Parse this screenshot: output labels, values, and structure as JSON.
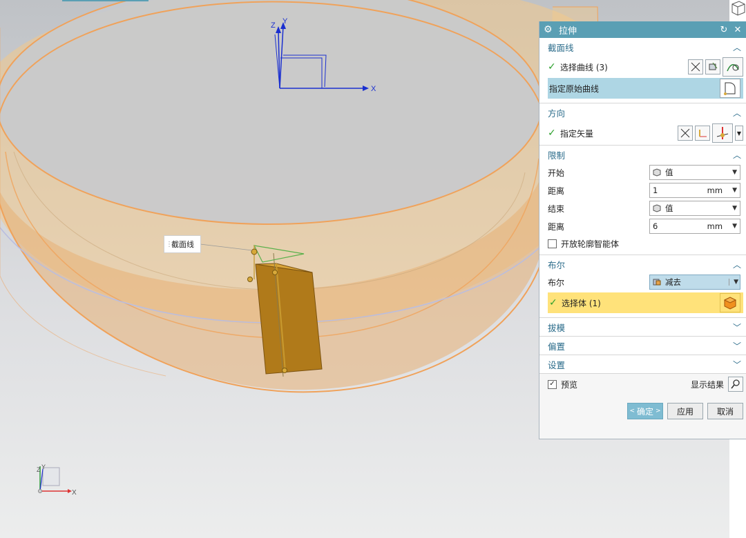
{
  "dialog": {
    "title": "拉伸",
    "sections": {
      "section_curve": {
        "title": "截面线",
        "select_curve": "选择曲线 (3)",
        "original_curve": "指定原始曲线"
      },
      "direction": {
        "title": "方向",
        "vector": "指定矢量"
      },
      "limits": {
        "title": "限制",
        "start_label": "开始",
        "start_value": "值",
        "dist1_label": "距离",
        "dist1_value": "1",
        "dist1_unit": "mm",
        "end_label": "结束",
        "end_value": "值",
        "dist2_label": "距离",
        "dist2_value": "6",
        "dist2_unit": "mm",
        "open_profile": "开放轮廓智能体"
      },
      "boolean": {
        "title": "布尔",
        "label": "布尔",
        "value": "减去",
        "select_body": "选择体 (1)"
      },
      "draft": {
        "title": "拔模"
      },
      "offset": {
        "title": "偏置"
      },
      "settings": {
        "title": "设置"
      }
    },
    "preview_label": "预览",
    "preview_checked": true,
    "show_result": "显示结果",
    "ok": "确定",
    "apply": "应用",
    "cancel": "取消"
  },
  "viewport": {
    "section_label": "截面线",
    "axis_x": "X",
    "axis_y": "Y",
    "axis_z": "Z",
    "triad_x": "X",
    "triad_y": "Y",
    "triad_z": "Z"
  },
  "colors": {
    "accent": "#5a9fb4",
    "ring_fill": "#f3c98a",
    "ring_edge": "#f0a25a",
    "block": "#b07a1a",
    "select_highlight": "#ffe27a"
  }
}
